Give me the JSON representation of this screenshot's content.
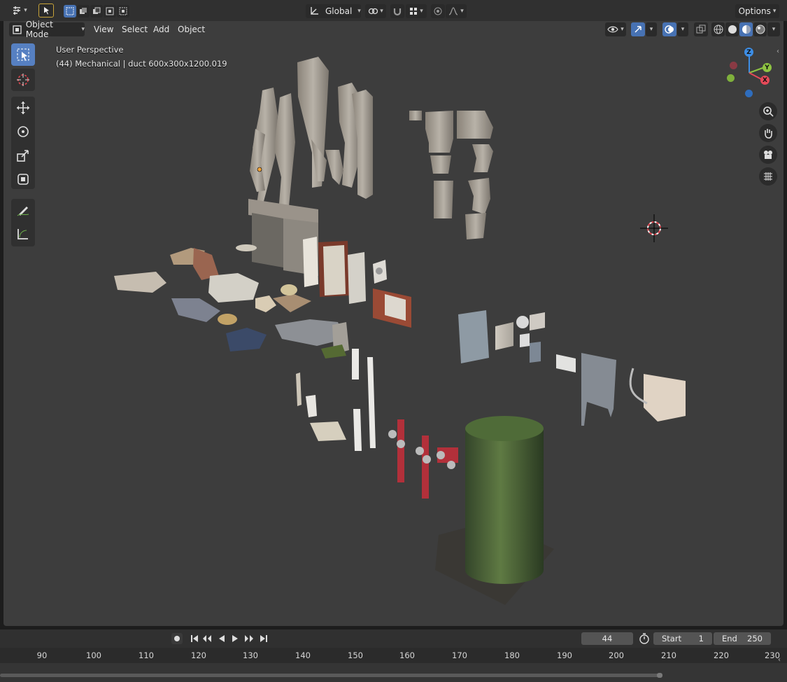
{
  "header": {
    "orientation": "Global",
    "options_label": "Options"
  },
  "menubar": {
    "mode": "Object Mode",
    "items": [
      "View",
      "Select",
      "Add",
      "Object"
    ]
  },
  "viewport": {
    "perspective_label": "User Perspective",
    "object_label": "(44) Mechanical | duct 600x300x1200.019",
    "gizmo": {
      "z": "Z",
      "y": "Y",
      "x": "X"
    }
  },
  "timeline": {
    "current_frame": "44",
    "start_label": "Start",
    "start_value": "1",
    "end_label": "End",
    "end_value": "250",
    "ruler_ticks": [
      "90",
      "100",
      "110",
      "120",
      "130",
      "140",
      "150",
      "160",
      "170",
      "180",
      "190",
      "200",
      "210",
      "220",
      "230"
    ]
  },
  "colors": {
    "accent": "#4772b3",
    "axis_x": "#e64a59",
    "axis_y": "#8ec442",
    "axis_z": "#3d8ee6"
  },
  "icons": {
    "editor_type": "editor-type-icon",
    "select": "select-cursor-icon",
    "cursor": "3d-cursor-icon",
    "move": "move-icon",
    "rotate": "rotate-icon",
    "scale": "scale-icon",
    "transform": "transform-icon",
    "annotate": "annotate-icon",
    "measure": "measure-icon",
    "zoom": "zoom-icon",
    "pan": "hand-icon",
    "camera": "camera-icon",
    "grid": "grid-icon"
  }
}
